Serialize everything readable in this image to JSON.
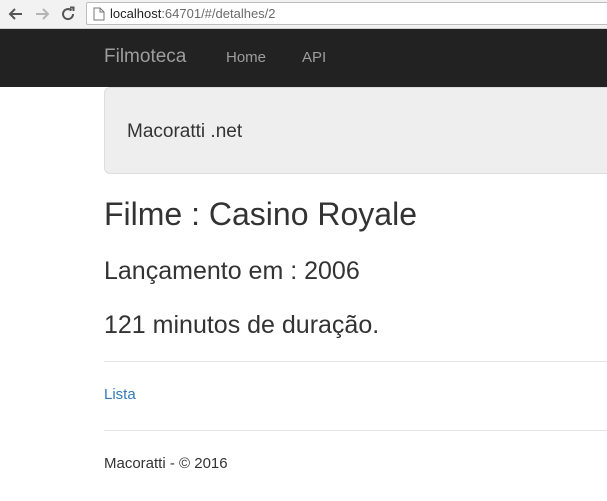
{
  "browser": {
    "url_host": "localhost",
    "url_rest": ":64701/#/detalhes/2"
  },
  "navbar": {
    "brand": "Filmoteca",
    "links": [
      {
        "label": "Home"
      },
      {
        "label": "API"
      }
    ]
  },
  "jumbotron": {
    "text": "Macoratti .net"
  },
  "movie": {
    "title": "Filme : Casino Royale",
    "release": "Lançamento em : 2006",
    "duration": "121 minutos de duração."
  },
  "links": {
    "list_label": "Lista"
  },
  "footer": {
    "text": "Macoratti - © 2016"
  },
  "colors": {
    "navbar_bg": "#222222",
    "nav_text": "#9d9d9d",
    "link": "#337ab7",
    "jumbotron_bg": "#eeeeee"
  },
  "icons": [
    "back-arrow-icon",
    "forward-arrow-icon",
    "reload-icon",
    "page-icon"
  ]
}
